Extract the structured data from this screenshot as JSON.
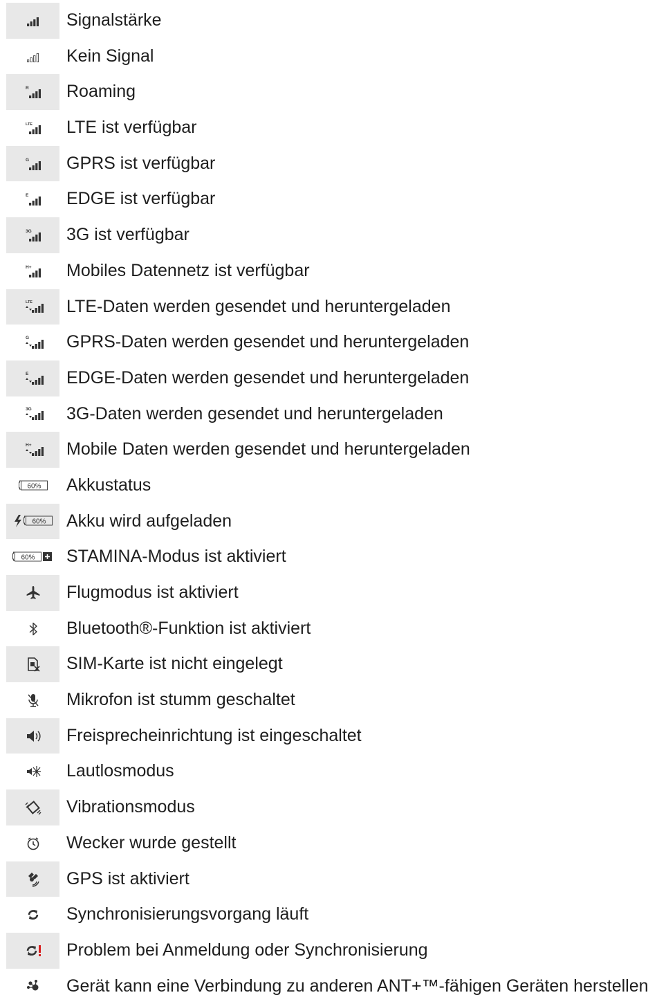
{
  "items": [
    {
      "label": "Signalstärke",
      "icon": "signal-strength-icon",
      "shaded": true
    },
    {
      "label": "Kein Signal",
      "icon": "no-signal-icon",
      "shaded": false
    },
    {
      "label": "Roaming",
      "icon": "roaming-icon",
      "shaded": true,
      "badge": "R"
    },
    {
      "label": "LTE ist verfügbar",
      "icon": "lte-available-icon",
      "shaded": false,
      "badge": "LTE"
    },
    {
      "label": "GPRS ist verfügbar",
      "icon": "gprs-available-icon",
      "shaded": true,
      "badge": "G"
    },
    {
      "label": "EDGE ist verfügbar",
      "icon": "edge-available-icon",
      "shaded": false,
      "badge": "E"
    },
    {
      "label": "3G ist verfügbar",
      "icon": "3g-available-icon",
      "shaded": true,
      "badge": "3G"
    },
    {
      "label": "Mobiles Datennetz ist verfügbar",
      "icon": "mobile-data-available-icon",
      "shaded": false,
      "badge": "H+"
    },
    {
      "label": "LTE-Daten werden gesendet und heruntergeladen",
      "icon": "lte-data-transfer-icon",
      "shaded": true,
      "badge": "LTE"
    },
    {
      "label": "GPRS-Daten werden gesendet und heruntergeladen",
      "icon": "gprs-data-transfer-icon",
      "shaded": false,
      "badge": "G"
    },
    {
      "label": "EDGE-Daten werden gesendet und heruntergeladen",
      "icon": "edge-data-transfer-icon",
      "shaded": true,
      "badge": "E"
    },
    {
      "label": "3G-Daten werden gesendet und heruntergeladen",
      "icon": "3g-data-transfer-icon",
      "shaded": false,
      "badge": "3G"
    },
    {
      "label": "Mobile Daten werden gesendet und heruntergeladen",
      "icon": "mobile-data-transfer-icon",
      "shaded": true,
      "badge": "H+"
    },
    {
      "label": "Akkustatus",
      "icon": "battery-status-icon",
      "shaded": false,
      "badge": "60%"
    },
    {
      "label": "Akku wird aufgeladen",
      "icon": "battery-charging-icon",
      "shaded": true,
      "badge": "60%"
    },
    {
      "label": "STAMINA-Modus ist aktiviert",
      "icon": "stamina-mode-icon",
      "shaded": false,
      "badge": "60%"
    },
    {
      "label": "Flugmodus ist aktiviert",
      "icon": "airplane-mode-icon",
      "shaded": true
    },
    {
      "label": "Bluetooth®-Funktion ist aktiviert",
      "icon": "bluetooth-icon",
      "shaded": false
    },
    {
      "label": "SIM-Karte ist nicht eingelegt",
      "icon": "sim-card-missing-icon",
      "shaded": true
    },
    {
      "label": "Mikrofon ist stumm geschaltet",
      "icon": "microphone-muted-icon",
      "shaded": false
    },
    {
      "label": "Freisprecheinrichtung ist eingeschaltet",
      "icon": "speakerphone-icon",
      "shaded": true
    },
    {
      "label": "Lautlosmodus",
      "icon": "silent-mode-icon",
      "shaded": false
    },
    {
      "label": "Vibrationsmodus",
      "icon": "vibrate-mode-icon",
      "shaded": true
    },
    {
      "label": "Wecker wurde gestellt",
      "icon": "alarm-clock-icon",
      "shaded": false
    },
    {
      "label": "GPS ist aktiviert",
      "icon": "gps-icon",
      "shaded": true
    },
    {
      "label": "Synchronisierungsvorgang läuft",
      "icon": "sync-icon",
      "shaded": false
    },
    {
      "label": "Problem bei Anmeldung oder Synchronisierung",
      "icon": "sync-problem-icon",
      "shaded": true
    },
    {
      "label": "Gerät kann eine Verbindung zu anderen ANT+™-fähigen Geräten herstellen",
      "icon": "ant-plus-icon",
      "shaded": false
    }
  ],
  "colors": {
    "icon": "#333333",
    "shade": "#e8e8e8",
    "warning": "#d81e1e"
  }
}
